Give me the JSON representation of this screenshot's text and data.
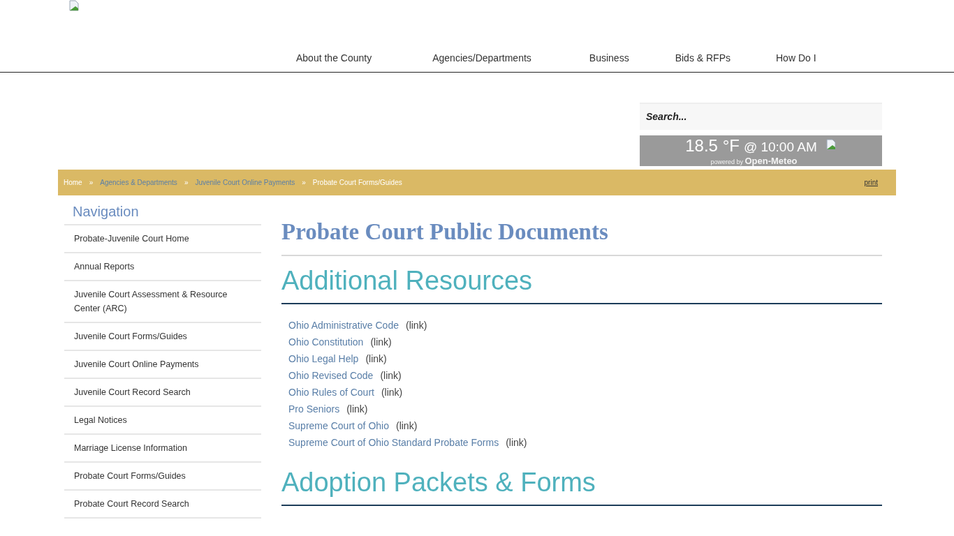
{
  "header": {
    "nav": [
      "About the County",
      "Agencies/Departments",
      "Business",
      "Bids & RFPs",
      "How Do I"
    ]
  },
  "search": {
    "placeholder": "Search..."
  },
  "weather": {
    "reading": "18.5 °F",
    "time": "@ 10:00 AM",
    "powered_by": "powered by",
    "provider": "Open-Meteo"
  },
  "breadcrumb": {
    "items": [
      {
        "label": "Home",
        "kind": "home"
      },
      {
        "label": "Agencies & Departments",
        "kind": "link"
      },
      {
        "label": "Juvenile Court Online Payments",
        "kind": "link"
      },
      {
        "label": "Probate Court Forms/Guides",
        "kind": "current"
      }
    ],
    "separator": "»",
    "print": "print"
  },
  "sidebar": {
    "title": "Navigation",
    "items": [
      "Probate-Juvenile Court Home",
      "Annual Reports",
      "Juvenile Court Assessment & Resource Center (ARC)",
      "Juvenile Court Forms/Guides",
      "Juvenile Court Online Payments",
      "Juvenile Court Record Search",
      "Legal Notices",
      "Marriage License Information",
      "Probate Court Forms/Guides",
      "Probate Court Record Search"
    ]
  },
  "main": {
    "title": "Probate Court Public Documents",
    "sections": [
      {
        "heading": "Additional Resources",
        "links": [
          {
            "label": "Ohio Administrative Code",
            "note": "(link)"
          },
          {
            "label": "Ohio Constitution",
            "note": "(link)"
          },
          {
            "label": "Ohio Legal Help",
            "note": "(link)"
          },
          {
            "label": "Ohio Revised Code",
            "note": "(link)"
          },
          {
            "label": "Ohio Rules of Court",
            "note": "(link)"
          },
          {
            "label": "Pro Seniors",
            "note": "(link)"
          },
          {
            "label": "Supreme Court of Ohio",
            "note": "(link)"
          },
          {
            "label": "Supreme Court of Ohio Standard Probate Forms",
            "note": "(link)"
          }
        ]
      },
      {
        "heading": "Adoption Packets & Forms"
      }
    ]
  }
}
